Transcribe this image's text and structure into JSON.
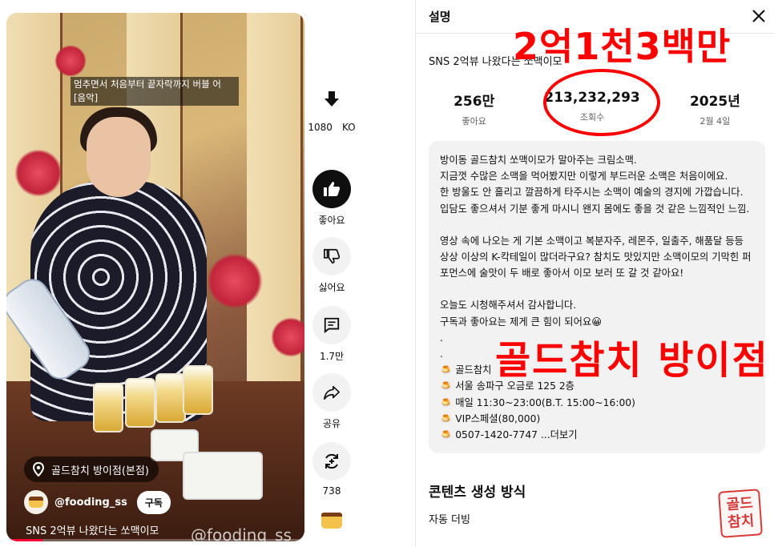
{
  "video": {
    "caption_line1": "멈추면서 처음부터 끝자락까지 버블 어",
    "caption_line2": "[음악]",
    "location": "골드참치 방이점(본점)",
    "channel": "@fooding_ss",
    "subscribe_label": "구독",
    "title": "SNS 2억뷰 나왔다는 쏘맥이모",
    "watermark": "@fooding_ss",
    "progress_percent": 12
  },
  "rail": {
    "download_label": "1080　KO",
    "like_label": "좋아요",
    "dislike_label": "싫어요",
    "comments_label": "1.7만",
    "share_label": "공유",
    "remix_label": "738"
  },
  "description": {
    "header": "설명",
    "video_title": "SNS 2억뷰 나왔다는 쏘맥이모",
    "stats": [
      {
        "value": "256만",
        "label": "좋아요"
      },
      {
        "value": "213,232,293",
        "label": "조회수"
      },
      {
        "value": "2025년",
        "label": "2월 4일"
      }
    ],
    "body_p1": "방이동 골드참치 쏘맥이모가 말아주는 크림소맥.\n지금껏 수많은 소맥을 먹어봤지만 이렇게 부드러운 소맥은 처음이에요.\n한 방울도 안 흘리고 깔끔하게 타주시는 소맥이 예술의 경지에 가깝습니다. 입담도 좋으셔서 기분 좋게 마시니 왠지 몸에도 좋을 것 같은 느낌적인 느낌.",
    "body_p2": "영상 속에 나오는 게 기본 소맥이고 복분자주, 레몬주, 일출주, 해품달 등등 상상 이상의 K-칵테일이 많더라구요? 참치도 맛있지만 소맥이모의 기막힌 퍼포먼스에 술맛이 두 배로 좋아서 이모 보러 또 갈 것 같아요!",
    "body_p3": "오늘도 시청해주셔서 감사합니다.\n구독과 좋아요는 제게 큰 힘이 되어요😀\n.\n.",
    "info": [
      "🍮 골드참치",
      "🍮 서울 송파구 오금로 125 2층",
      "🍮 매일 11:30~23:00(B.T. 15:00~16:00)",
      "🍮 VIP스페셜(80,000)",
      "🍮 0507-1420-7747 "
    ],
    "more_label": "...더보기",
    "section_title": "콘텐츠 생성 방식",
    "section_sub": "자동 더빙"
  },
  "annotations": {
    "top": "2억1천3백만",
    "middle": "골드참치 방이점"
  },
  "seal_text": [
    "골드",
    "참치"
  ],
  "colors": {
    "annotation": "#ff0000",
    "progress": "#ff0033"
  }
}
